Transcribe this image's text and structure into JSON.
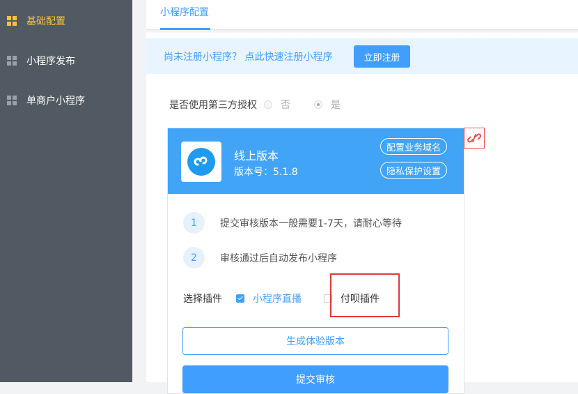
{
  "sidebar": {
    "items": [
      {
        "label": "基础配置",
        "active": true
      },
      {
        "label": "小程序发布",
        "active": false
      },
      {
        "label": "单商户小程序",
        "active": false
      }
    ]
  },
  "tab": {
    "label": "小程序配置"
  },
  "notice": {
    "text": "尚未注册小程序？ 点此快速注册小程序",
    "button": "立即注册"
  },
  "auth": {
    "label": "是否使用第三方授权",
    "options": [
      "否",
      "是"
    ],
    "selected": "是"
  },
  "card": {
    "version_title": "线上版本",
    "version_number": "版本号：5.1.8",
    "domain_button": "配置业务域名",
    "privacy_button": "隐私保护设置",
    "steps": [
      {
        "num": "1",
        "text": "提交审核版本一般需要1-7天，请耐心等待"
      },
      {
        "num": "2",
        "text": "审核通过后自动发布小程序"
      }
    ],
    "plugin_label": "选择插件",
    "plugins": [
      {
        "label": "小程序直播",
        "checked": true
      },
      {
        "label": "付呗插件",
        "checked": false
      }
    ],
    "trial_button": "生成体验版本",
    "submit_button": "提交审核"
  },
  "colors": {
    "accent": "#409eff",
    "sidebar": "#515a62",
    "sidebar_active": "#f5c33b",
    "card_header": "#41a4f7",
    "highlight": "#e53935"
  }
}
